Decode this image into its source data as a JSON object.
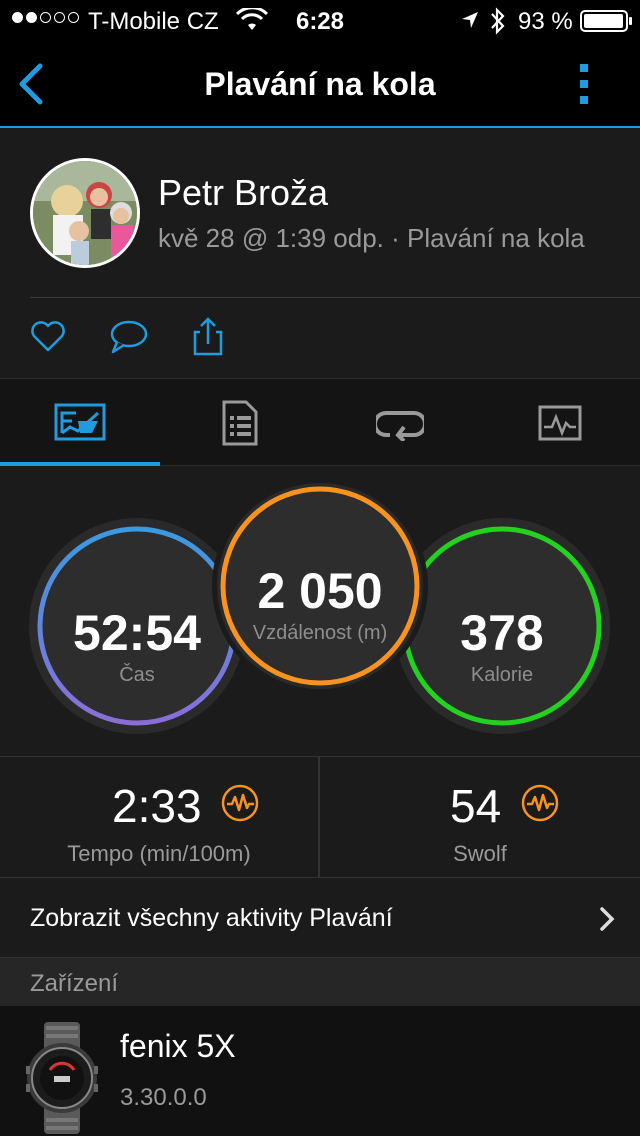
{
  "status_bar": {
    "carrier": "T-Mobile CZ",
    "time": "6:28",
    "battery": "93 %",
    "signal_strength": 2
  },
  "nav": {
    "title": "Plavání na kola",
    "back_icon": "chevron-left-icon",
    "more_icon": "vertical-dots-icon"
  },
  "header": {
    "user_name": "Petr Broža",
    "meta": "kvě 28 @ 1:39 odp. · Plavání na kola",
    "actions": [
      "heart-icon",
      "comment-icon",
      "share-icon"
    ]
  },
  "tabs": [
    {
      "icon": "overview-icon",
      "active": true
    },
    {
      "icon": "details-icon",
      "active": false
    },
    {
      "icon": "laps-icon",
      "active": false
    },
    {
      "icon": "charts-icon",
      "active": false
    }
  ],
  "rings": {
    "time": {
      "value": "52:54",
      "label": "Čas"
    },
    "distance": {
      "value": "2 050",
      "label": "Vzdálenost (m)"
    },
    "calories": {
      "value": "378",
      "label": "Kalorie"
    }
  },
  "stats": {
    "pace": {
      "value": "2:33",
      "label": "Tempo (min/100m)"
    },
    "swolf": {
      "value": "54",
      "label": "Swolf"
    }
  },
  "link": {
    "label": "Zobrazit všechny aktivity Plavání"
  },
  "devices": {
    "section_title": "Zařízení",
    "name": "fenix 5X",
    "version": "3.30.0.0"
  },
  "colors": {
    "accent": "#1f9cdd",
    "orange": "#f7931e",
    "green": "#22d21f",
    "blue_ring": "#3a9ae0",
    "purple_ring": "#8a6ed8"
  }
}
